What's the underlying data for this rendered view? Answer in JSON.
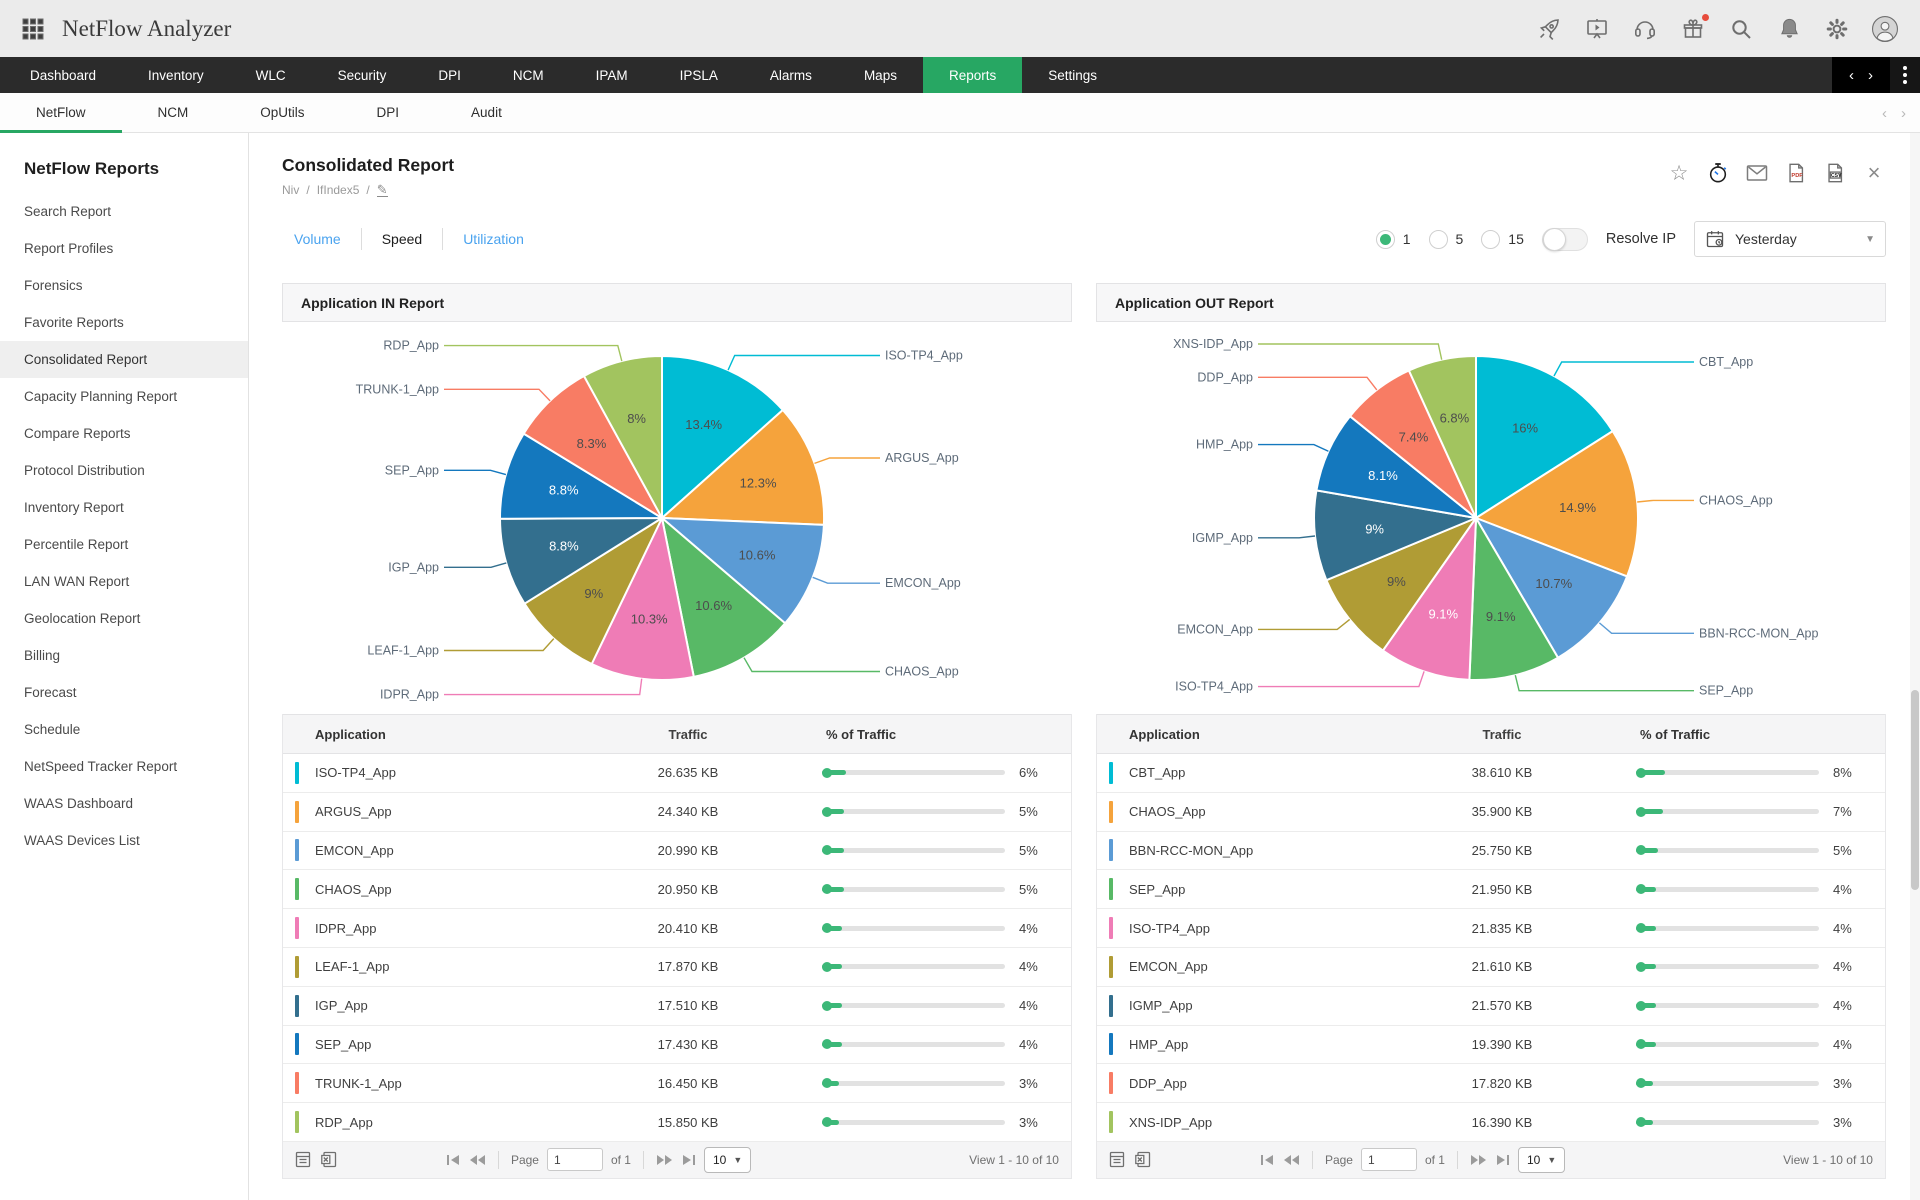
{
  "app": {
    "title": "NetFlow Analyzer"
  },
  "colors": {
    "accent_green": "#27a763",
    "link_blue": "#4aa3ef",
    "progress_green": "#3cb878",
    "gift_badge": "#e74c3c",
    "palette": [
      "#00BCD4",
      "#F5A33C",
      "#5B9BD5",
      "#58B966",
      "#EF7CB6",
      "#B09C35",
      "#336F8E",
      "#1478BE",
      "#F87C64",
      "#A2C45F"
    ]
  },
  "topbar_icons": [
    "rocket",
    "demo-player",
    "headset",
    "gift",
    "search",
    "bell",
    "gear",
    "avatar"
  ],
  "nav": {
    "items": [
      "Dashboard",
      "Inventory",
      "WLC",
      "Security",
      "DPI",
      "NCM",
      "IPAM",
      "IPSLA",
      "Alarms",
      "Maps",
      "Reports",
      "Settings"
    ],
    "active_index": 10
  },
  "subnav": {
    "items": [
      "NetFlow",
      "NCM",
      "OpUtils",
      "DPI",
      "Audit"
    ],
    "active_index": 0
  },
  "sidebar": {
    "title": "NetFlow Reports",
    "items": [
      "Search Report",
      "Report Profiles",
      "Forensics",
      "Favorite Reports",
      "Consolidated Report",
      "Capacity Planning Report",
      "Compare Reports",
      "Protocol Distribution",
      "Inventory Report",
      "Percentile Report",
      "LAN WAN Report",
      "Geolocation Report",
      "Billing",
      "Forecast",
      "Schedule",
      "NetSpeed Tracker Report",
      "WAAS Dashboard",
      "WAAS Devices List"
    ],
    "active_index": 4
  },
  "report": {
    "title": "Consolidated Report",
    "breadcrumb": [
      "Niv",
      "IfIndex5"
    ],
    "breadcrumb_sep": "/",
    "view_tabs": [
      {
        "label": "Volume",
        "state": "link"
      },
      {
        "label": "Speed",
        "state": "active"
      },
      {
        "label": "Utilization",
        "state": "link"
      }
    ],
    "interval": {
      "options": [
        "1",
        "5",
        "15"
      ],
      "selected": "1"
    },
    "resolve_ip_label": "Resolve IP",
    "resolve_ip_on": false,
    "date_range": "Yesterday"
  },
  "chart_data": [
    {
      "type": "pie",
      "title": "Application IN Report",
      "labels": [
        "ISO-TP4_App",
        "ARGUS_App",
        "EMCON_App",
        "CHAOS_App",
        "IDPR_App",
        "LEAF-1_App",
        "IGP_App",
        "SEP_App",
        "TRUNK-1_App",
        "RDP_App"
      ],
      "values": [
        13.4,
        12.3,
        10.6,
        10.6,
        10.3,
        9,
        8.8,
        8.8,
        8.3,
        8
      ],
      "white_label_indices": [
        6,
        7
      ],
      "legend_position": "outside-leader-lines",
      "start_angle_deg": 0
    },
    {
      "type": "pie",
      "title": "Application OUT Report",
      "labels": [
        "CBT_App",
        "CHAOS_App",
        "BBN-RCC-MON_App",
        "SEP_App",
        "ISO-TP4_App",
        "EMCON_App",
        "IGMP_App",
        "HMP_App",
        "DDP_App",
        "XNS-IDP_App"
      ],
      "values": [
        16,
        14.9,
        10.7,
        9.1,
        9.1,
        9,
        9,
        8.1,
        7.4,
        6.8
      ],
      "white_label_indices": [
        4,
        6,
        7
      ],
      "legend_position": "outside-leader-lines",
      "start_angle_deg": 0
    }
  ],
  "panels": [
    {
      "title": "Application IN Report",
      "table": {
        "headers": [
          "Application",
          "Traffic",
          "% of Traffic"
        ],
        "rows": [
          {
            "app": "ISO-TP4_App",
            "traffic": "26.635 KB",
            "pct": "6%",
            "pct_value": 6
          },
          {
            "app": "ARGUS_App",
            "traffic": "24.340 KB",
            "pct": "5%",
            "pct_value": 5
          },
          {
            "app": "EMCON_App",
            "traffic": "20.990 KB",
            "pct": "5%",
            "pct_value": 5
          },
          {
            "app": "CHAOS_App",
            "traffic": "20.950 KB",
            "pct": "5%",
            "pct_value": 5
          },
          {
            "app": "IDPR_App",
            "traffic": "20.410 KB",
            "pct": "4%",
            "pct_value": 4
          },
          {
            "app": "LEAF-1_App",
            "traffic": "17.870 KB",
            "pct": "4%",
            "pct_value": 4
          },
          {
            "app": "IGP_App",
            "traffic": "17.510 KB",
            "pct": "4%",
            "pct_value": 4
          },
          {
            "app": "SEP_App",
            "traffic": "17.430 KB",
            "pct": "4%",
            "pct_value": 4
          },
          {
            "app": "TRUNK-1_App",
            "traffic": "16.450 KB",
            "pct": "3%",
            "pct_value": 3
          },
          {
            "app": "RDP_App",
            "traffic": "15.850 KB",
            "pct": "3%",
            "pct_value": 3
          }
        ]
      },
      "pagination": {
        "page_label": "Page",
        "page": "1",
        "of_label": "of 1",
        "page_size": "10",
        "view": "View 1 - 10 of 10"
      }
    },
    {
      "title": "Application OUT Report",
      "table": {
        "headers": [
          "Application",
          "Traffic",
          "% of Traffic"
        ],
        "rows": [
          {
            "app": "CBT_App",
            "traffic": "38.610 KB",
            "pct": "8%",
            "pct_value": 8
          },
          {
            "app": "CHAOS_App",
            "traffic": "35.900 KB",
            "pct": "7%",
            "pct_value": 7
          },
          {
            "app": "BBN-RCC-MON_App",
            "traffic": "25.750 KB",
            "pct": "5%",
            "pct_value": 5
          },
          {
            "app": "SEP_App",
            "traffic": "21.950 KB",
            "pct": "4%",
            "pct_value": 4
          },
          {
            "app": "ISO-TP4_App",
            "traffic": "21.835 KB",
            "pct": "4%",
            "pct_value": 4
          },
          {
            "app": "EMCON_App",
            "traffic": "21.610 KB",
            "pct": "4%",
            "pct_value": 4
          },
          {
            "app": "IGMP_App",
            "traffic": "21.570 KB",
            "pct": "4%",
            "pct_value": 4
          },
          {
            "app": "HMP_App",
            "traffic": "19.390 KB",
            "pct": "4%",
            "pct_value": 4
          },
          {
            "app": "DDP_App",
            "traffic": "17.820 KB",
            "pct": "3%",
            "pct_value": 3
          },
          {
            "app": "XNS-IDP_App",
            "traffic": "16.390 KB",
            "pct": "3%",
            "pct_value": 3
          }
        ]
      },
      "pagination": {
        "page_label": "Page",
        "page": "1",
        "of_label": "of 1",
        "page_size": "10",
        "view": "View 1 - 10 of 10"
      }
    }
  ]
}
